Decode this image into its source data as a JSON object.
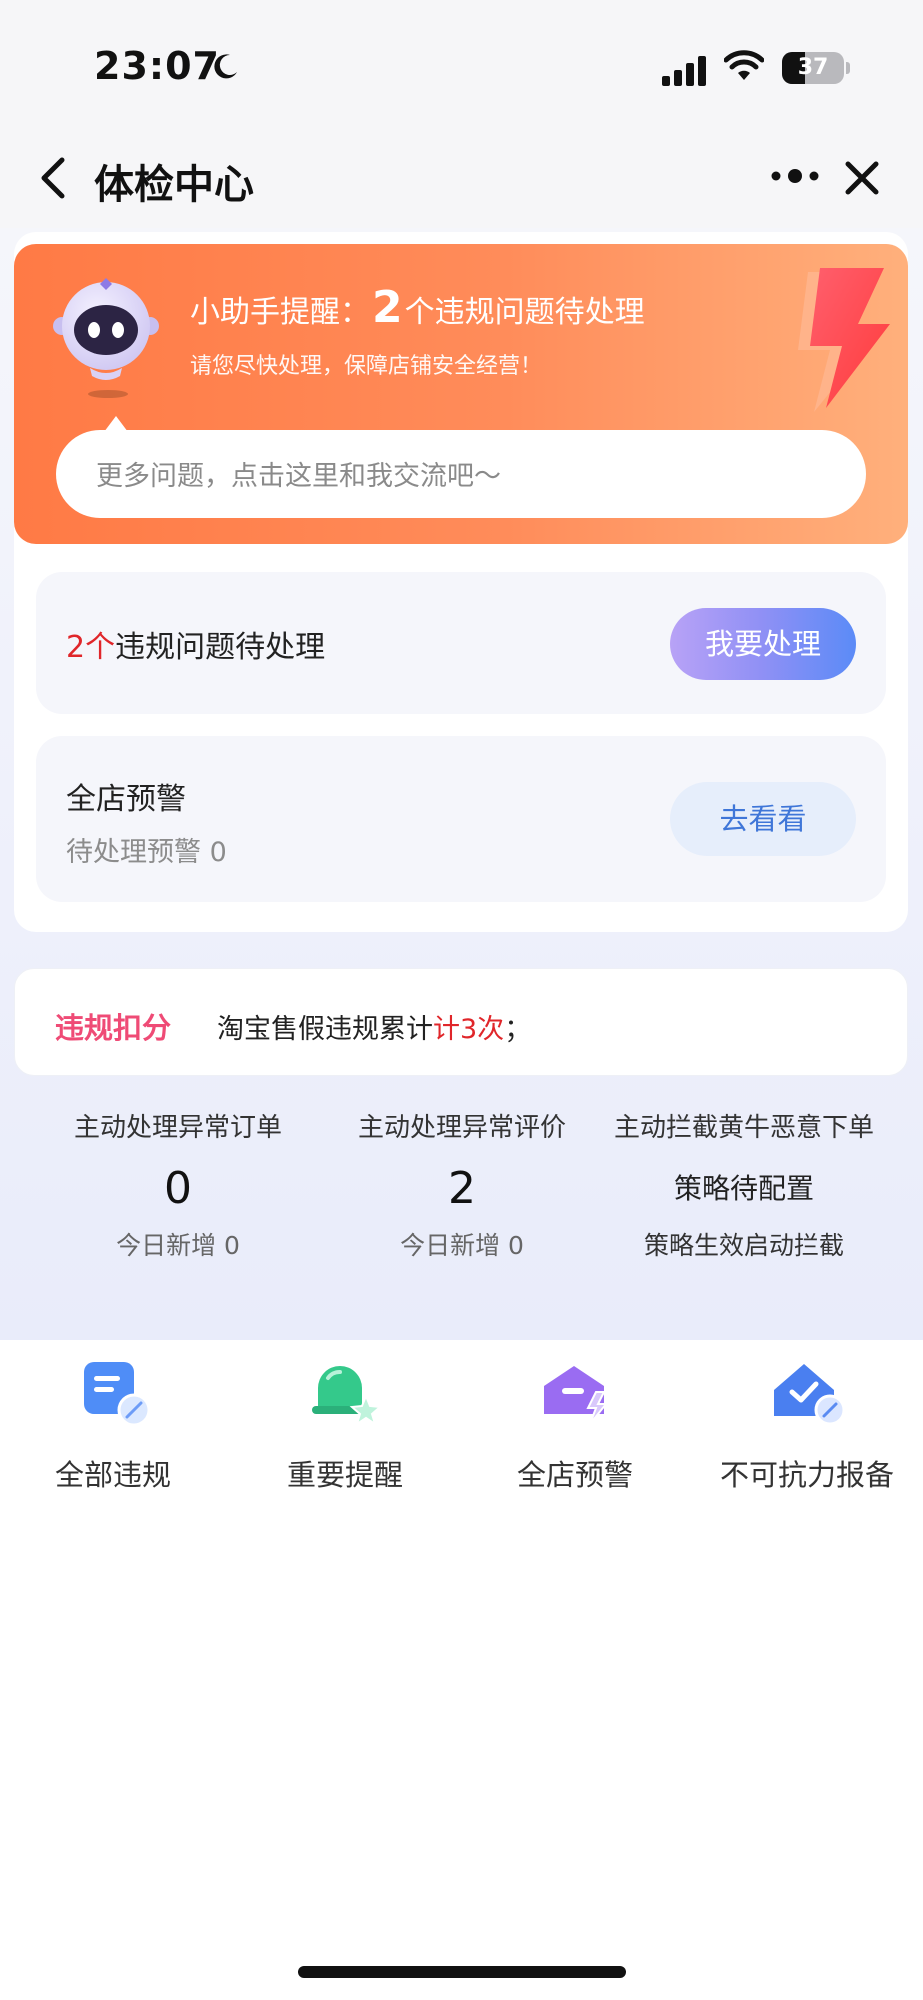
{
  "status_bar": {
    "time": "23:07",
    "battery": "37",
    "battery_level": 0.37
  },
  "nav": {
    "title": "体检中心"
  },
  "assistant": {
    "title_prefix": "小助手提醒：",
    "count": "2",
    "title_suffix": "个违规问题待处理",
    "subtitle": "请您尽快处理，保障店铺安全经营！",
    "chat_placeholder": "更多问题，点击这里和我交流吧～"
  },
  "pending": {
    "count": "2个",
    "text": "违规问题待处理",
    "button": "我要处理"
  },
  "store_warning": {
    "title": "全店预警",
    "subtitle": "待处理预警 0",
    "button": "去看看"
  },
  "penalty": {
    "label": "违规扣分",
    "text": "淘宝售假违规累计",
    "highlight": "计3次",
    "suffix": "；"
  },
  "stats": [
    {
      "title": "主动处理异常订单",
      "value": "0",
      "sub": "今日新增 0"
    },
    {
      "title": "主动处理异常评价",
      "value": "2",
      "sub": "今日新增 0"
    },
    {
      "title": "主动拦截黄牛恶意下单",
      "value": "策略待配置",
      "sub": "策略生效启动拦截"
    }
  ],
  "bottom_nav": [
    {
      "label": "全部违规",
      "icon": "document-icon",
      "color": "#4f8df7"
    },
    {
      "label": "重要提醒",
      "icon": "bell-icon",
      "color": "#34c98b"
    },
    {
      "label": "全店预警",
      "icon": "mail-warning-icon",
      "color": "#9a6cf2"
    },
    {
      "label": "不可抗力报备",
      "icon": "house-check-icon",
      "color": "#4a7ff0"
    }
  ],
  "colors": {
    "hero_start": "#ff7a45",
    "hero_end": "#ffb07c",
    "alert_red": "#e0262a",
    "penalty_pink": "#ef4b76",
    "link_blue": "#3f76d8"
  }
}
